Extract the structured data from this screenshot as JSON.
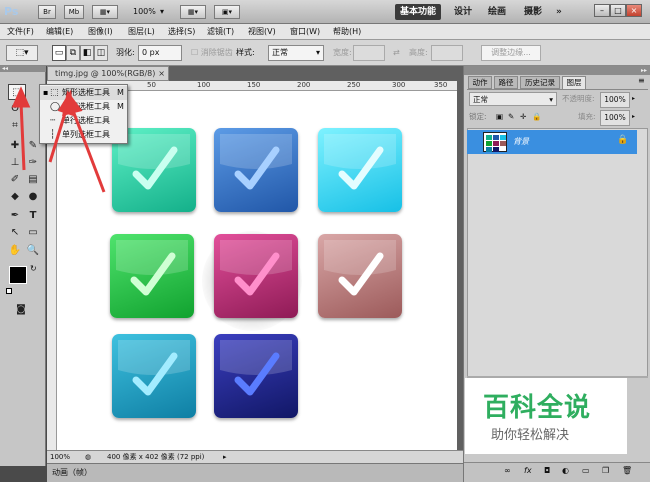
{
  "app": {
    "logo": "Ps",
    "bridge": "Br",
    "minibridge": "Mb",
    "zoom": "100%"
  },
  "workspaces": [
    "基本功能",
    "设计",
    "绘画",
    "摄影",
    "»"
  ],
  "window_controls": [
    "–",
    "□",
    "×"
  ],
  "menu": [
    "文件(F)",
    "编辑(E)",
    "图像(I)",
    "图层(L)",
    "选择(S)",
    "滤镜(T)",
    "视图(V)",
    "窗口(W)",
    "帮助(H)"
  ],
  "options": {
    "feather_label": "羽化:",
    "feather_value": "0 px",
    "antialias_label": "消除锯齿",
    "style_label": "样式:",
    "style_value": "正常",
    "width_label": "宽度:",
    "height_label": "高度:",
    "refine_edge": "调整边缘..."
  },
  "document": {
    "tab_title": "timg.jpg @ 100%(RGB/8)",
    "tab_close": "×",
    "ruler_ticks": [
      "50",
      "100",
      "150",
      "200",
      "250",
      "300",
      "350",
      "400",
      "450"
    ],
    "zoom_status": "100%",
    "doc_info": "400 像素 x 402 像素 (72 ppi)"
  },
  "flyout": {
    "items": [
      {
        "label": "矩形选框工具",
        "key": "M"
      },
      {
        "label": "椭圆选框工具",
        "key": "M"
      },
      {
        "label": "单行选框工具",
        "key": ""
      },
      {
        "label": "单列选框工具",
        "key": ""
      }
    ]
  },
  "tiles": [
    {
      "top": "#5ef0c6",
      "bottom": "#14b08a",
      "check": "#c9fff0"
    },
    {
      "top": "#5c9be6",
      "bottom": "#2157a8",
      "check": "#a8d0ff"
    },
    {
      "top": "#7ef2ff",
      "bottom": "#17c0e6",
      "check": "#e4fdff"
    },
    {
      "top": "#4fe36d",
      "bottom": "#11a22f",
      "check": "#d0ffd4"
    },
    {
      "top": "#e24f9a",
      "bottom": "#8f1b56",
      "check": "#ff8fcb"
    },
    {
      "top": "#d9a7a7",
      "bottom": "#9c5a5a",
      "check": "#ffffff"
    },
    {
      "top": "#3ec1df",
      "bottom": "#0f7fa4",
      "check": "#a3ecff"
    },
    {
      "top": "#3b3fbf",
      "bottom": "#111766",
      "check": "#5a7cff"
    }
  ],
  "animation_label": "动画（帧）",
  "panel": {
    "tabs": [
      "动作",
      "路径",
      "历史记录",
      "图层"
    ],
    "blend_mode": "正常",
    "opacity_label": "不透明度:",
    "opacity_value": "100%",
    "lock_label": "锁定:",
    "fill_label": "填充:",
    "fill_value": "100%",
    "layer_name": "背景",
    "bottom_icons": [
      "∞",
      "fx",
      "◘",
      "◐",
      "▭",
      "❐",
      "🗑"
    ]
  },
  "watermark": {
    "title": "百科全说",
    "subtitle": "助你轻松解决"
  },
  "colors": {
    "accent_red": "#e23b3b",
    "layer_selected": "#3a8fe0",
    "watermark_green": "#2fae5f"
  }
}
